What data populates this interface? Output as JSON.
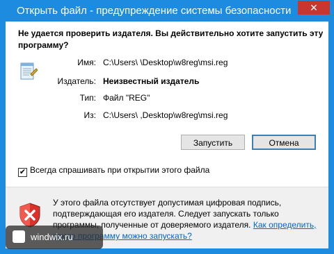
{
  "window": {
    "title": "Открыть файл - предупреждение системы безопасности",
    "close_label": "✕"
  },
  "question": "Не удается проверить издателя.  Вы действительно хотите запустить эту программу?",
  "details": {
    "name_label": "Имя:",
    "name_value": "C:\\Users\\            \\Desktop\\w8reg\\msi.reg",
    "publisher_label": "Издатель:",
    "publisher_value": "Неизвестный издатель",
    "type_label": "Тип:",
    "type_value": "Файл \"REG\"",
    "from_label": "Из:",
    "from_value": "C:\\Users\\            ,Desktop\\w8reg\\msi.reg"
  },
  "buttons": {
    "run": "Запустить",
    "cancel": "Отмена"
  },
  "checkbox": {
    "label": "Всегда спрашивать при открытии этого файла",
    "checked": true
  },
  "warning": {
    "text": "У этого файла отсутствует допустимая цифровая подпись, подтверждающая его издателя.  Следует запускать только программы, полученные от доверяемого издателя.",
    "link": "Как определить, какую программу можно запускать?"
  },
  "watermark": "windwix.ru",
  "colors": {
    "frame": "#1d8ce0",
    "close": "#c7372f",
    "link": "#0066cc"
  }
}
